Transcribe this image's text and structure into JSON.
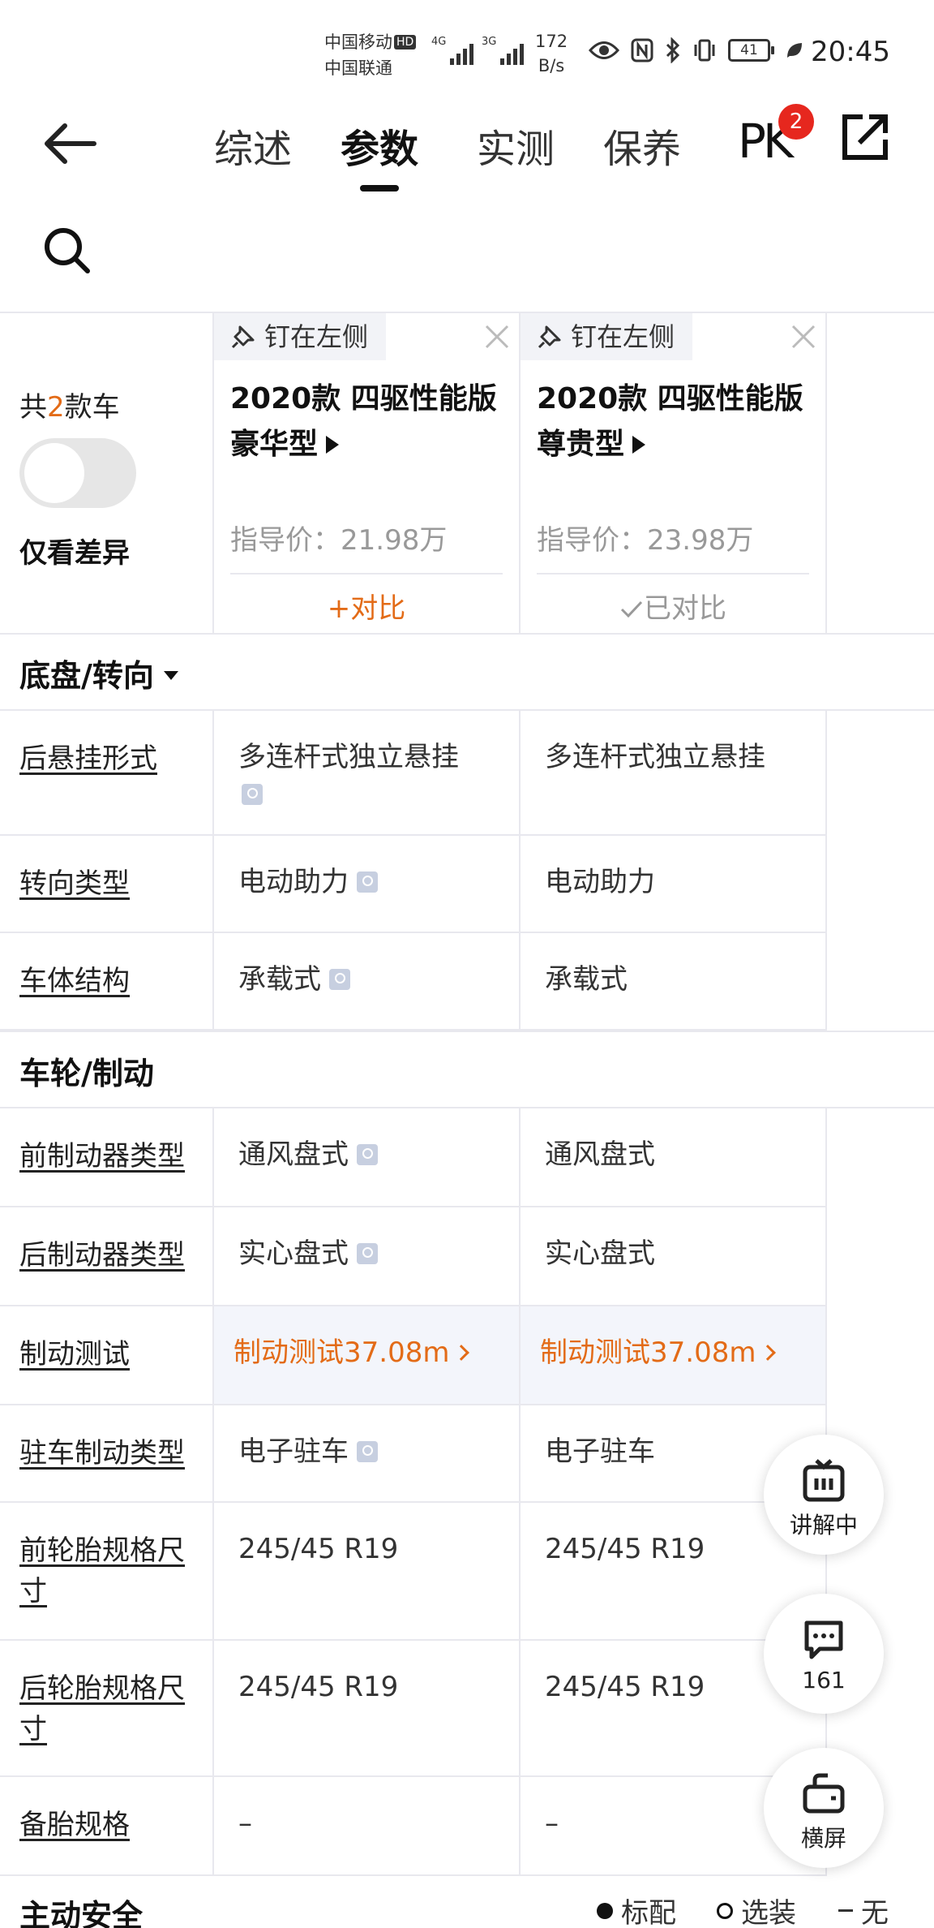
{
  "status_bar": {
    "carrier1": "中国移动",
    "carrier1_badge": "HD",
    "carrier2": "中国联通",
    "net1": "4G",
    "net2": "3G",
    "speed_value": "172",
    "speed_unit": "B/s",
    "battery": "41",
    "time": "20:45",
    "icons": [
      "eye-icon",
      "nfc-icon",
      "bluetooth-icon",
      "vibrate-icon",
      "battery-icon",
      "leaf-icon"
    ]
  },
  "nav": {
    "tabs": [
      "综述",
      "参数",
      "实测",
      "保养"
    ],
    "active_tab": "参数",
    "pk_label": "PK",
    "pk_badge": "2"
  },
  "compare": {
    "count_prefix": "共",
    "count": "2",
    "count_suffix": "款车",
    "only_diff_label": "仅看差异",
    "cars": [
      {
        "pin_label": "钉在左侧",
        "name": "2020款 四驱性能版豪华型",
        "price": "指导价：21.98万",
        "compare_label": "+对比",
        "compared": false
      },
      {
        "pin_label": "钉在左侧",
        "name": "2020款 四驱性能版尊贵型",
        "price": "指导价：23.98万",
        "compare_label": "已对比",
        "compared": true
      }
    ]
  },
  "sections": [
    {
      "title": "底盘/转向",
      "rows": [
        {
          "label": "后悬挂形式",
          "a": "多连杆式独立悬挂",
          "b": "多连杆式独立悬挂"
        },
        {
          "label": "转向类型",
          "a": "电动助力",
          "b": "电动助力"
        },
        {
          "label": "车体结构",
          "a": "承载式",
          "b": "承载式"
        }
      ]
    },
    {
      "title": "车轮/制动",
      "rows": [
        {
          "label": "前制动器类型",
          "a": "通风盘式",
          "b": "通风盘式"
        },
        {
          "label": "后制动器类型",
          "a": "实心盘式",
          "b": "实心盘式"
        },
        {
          "label": "制动测试",
          "a": "制动测试37.08m",
          "b": "制动测试37.08m"
        },
        {
          "label": "驻车制动类型",
          "a": "电子驻车",
          "b": "电子驻车"
        },
        {
          "label": "前轮胎规格尺寸",
          "a": "245/45 R19",
          "b": "245/45 R19"
        },
        {
          "label": "后轮胎规格尺寸",
          "a": "245/45 R19",
          "b": "245/45 R19"
        },
        {
          "label": "备胎规格",
          "a": "–",
          "b": "–"
        }
      ]
    },
    {
      "title": "主动安全"
    }
  ],
  "legend": {
    "standard": "标配",
    "optional": "选装",
    "none": "无"
  },
  "fabs": {
    "live": "讲解中",
    "comments": "161",
    "landscape": "横屏"
  }
}
